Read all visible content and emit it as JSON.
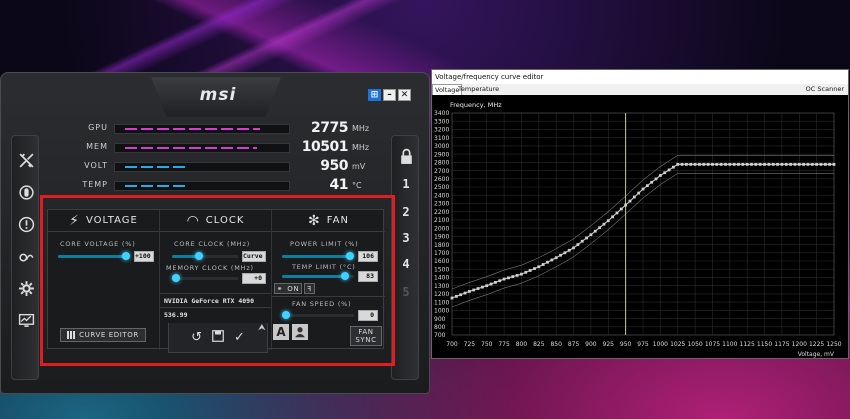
{
  "afterburner": {
    "logo": "msi",
    "window_buttons": [
      "⊞",
      "–",
      "✕"
    ],
    "left_icons": [
      "afterburner-icon",
      "power-icon",
      "info-icon",
      "oc-scanner-icon",
      "settings-icon",
      "monitor-icon"
    ],
    "profiles": [
      "1",
      "2",
      "3",
      "4",
      "5"
    ],
    "monitor": [
      {
        "label": "GPU",
        "value": "2775",
        "unit": "MHz",
        "level": 0.9,
        "color": "#d93ad6"
      },
      {
        "label": "MEM",
        "value": "10501",
        "unit": "MHz",
        "level": 0.88,
        "color": "#d93ad6"
      },
      {
        "label": "VOLT",
        "value": "950",
        "unit": "mV",
        "level": 0.4,
        "color": "#2aa9e8"
      },
      {
        "label": "TEMP",
        "value": "41",
        "unit": "°C",
        "level": 0.4,
        "color": "#2aa9e8"
      }
    ],
    "voltage": {
      "header": "VOLTAGE",
      "core_voltage_label": "CORE VOLTAGE (%)",
      "core_voltage_value": "+100",
      "core_voltage_level": 1.0,
      "curve_editor_label": "CURVE EDITOR"
    },
    "clock": {
      "header": "CLOCK",
      "core_clock_label": "CORE CLOCK (MHz)",
      "core_clock_value": "Curve",
      "core_clock_level": 0.4,
      "memory_clock_label": "MEMORY CLOCK (MHz)",
      "memory_clock_value": "+0",
      "memory_clock_level": 0.0,
      "gpu_name": "NVIDIA GeForce RTX 4090",
      "driver": "536.99"
    },
    "fan": {
      "header": "FAN",
      "power_limit_label": "POWER LIMIT (%)",
      "power_limit_value": "106",
      "power_limit_level": 1.0,
      "temp_limit_label": "TEMP LIMIT (°C)",
      "temp_limit_value": "83",
      "temp_limit_level": 0.92,
      "auto_toggle_label": "ON",
      "fan_speed_label": "FAN SPEED (%)",
      "fan_speed_value": "0",
      "fan_speed_level": 0.0,
      "fan_sync_line1": "FAN",
      "fan_sync_line2": "SYNC"
    },
    "bottom_actions": [
      "reset-icon",
      "save-icon",
      "apply-icon"
    ],
    "profile_buttons": [
      "A",
      "user-icon"
    ]
  },
  "curve_editor": {
    "title": "Voltage/frequency curve editor",
    "tabs": [
      "Voltage",
      "Temperature"
    ],
    "oc_scanner": "OC Scanner",
    "chart_data": {
      "type": "line",
      "ylabel": "Frequency, MHz",
      "xlabel": "Voltage, mV",
      "xlim": [
        700,
        1250
      ],
      "ylim": [
        700,
        3400
      ],
      "grid": true,
      "x_ticks": [
        700,
        725,
        750,
        775,
        800,
        825,
        850,
        875,
        900,
        925,
        950,
        975,
        1000,
        1025,
        1050,
        1075,
        1100,
        1125,
        1150,
        1175,
        1200,
        1225,
        1250
      ],
      "y_ticks": [
        700,
        800,
        900,
        1000,
        1100,
        1200,
        1300,
        1400,
        1500,
        1600,
        1700,
        1800,
        1900,
        2000,
        2100,
        2200,
        2300,
        2400,
        2500,
        2600,
        2700,
        2800,
        2900,
        3000,
        3100,
        3200,
        3300,
        3400
      ],
      "cursor_voltage": 950,
      "series": [
        {
          "x": [
            700,
            725,
            750,
            775,
            800,
            825,
            850,
            875,
            900,
            925,
            950,
            975,
            1000,
            1025,
            1050,
            1075,
            1100,
            1125,
            1150,
            1175,
            1200,
            1225,
            1250
          ],
          "y": [
            1150,
            1230,
            1300,
            1380,
            1440,
            1530,
            1640,
            1760,
            1920,
            2090,
            2280,
            2475,
            2640,
            2775,
            2775,
            2775,
            2775,
            2775,
            2775,
            2775,
            2775,
            2775,
            2775
          ]
        }
      ]
    }
  }
}
